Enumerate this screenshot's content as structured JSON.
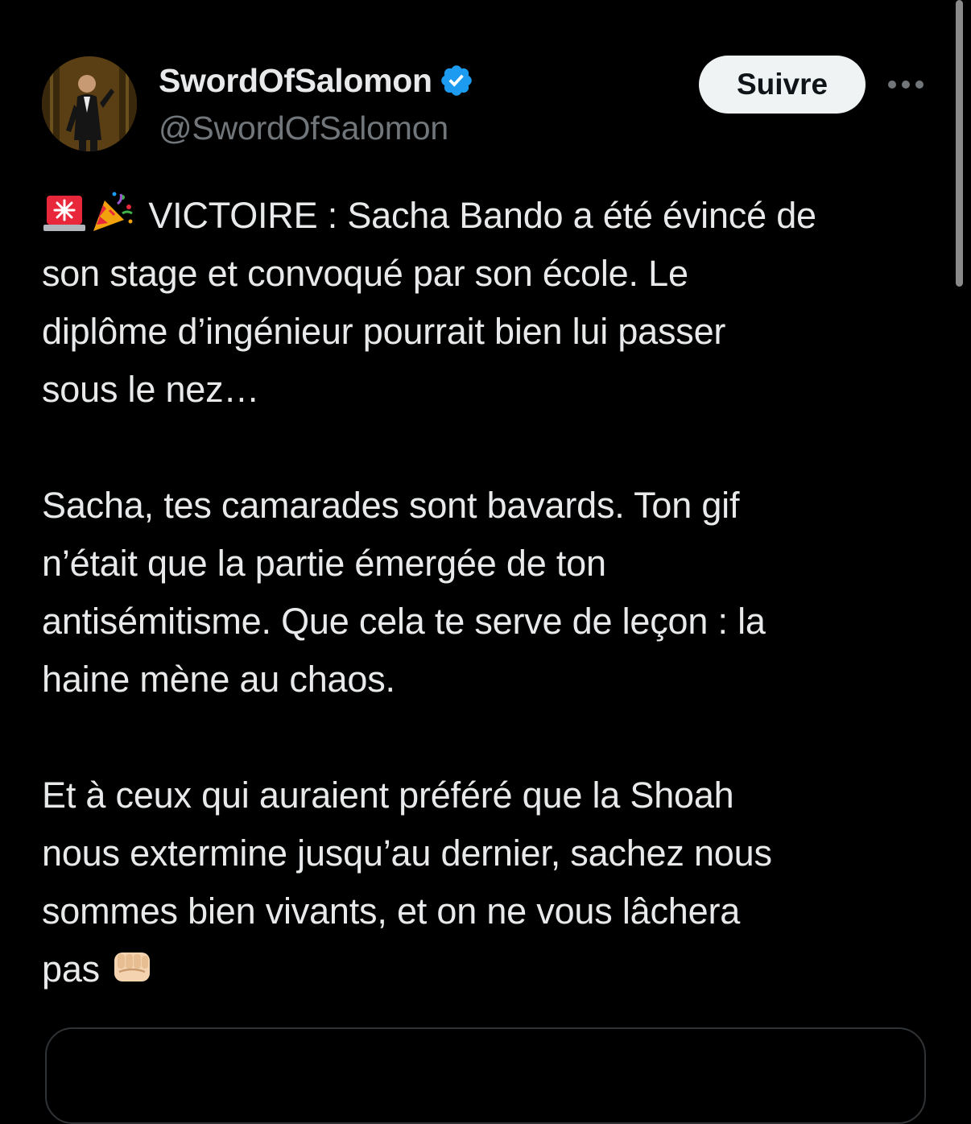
{
  "author": {
    "display_name": "SwordOfSalomon",
    "handle": "@SwordOfSalomon",
    "verified": true
  },
  "actions": {
    "follow_label": "Suivre",
    "more_icon": "more-horizontal-icon"
  },
  "tweet": {
    "emoji_1": "rotating-light-icon",
    "emoji_2": "party-popper-icon",
    "paragraph_1_lines": [
      "VICTOIRE : Sacha Bando a été évincé de",
      "son stage et convoqué par son école. Le",
      "diplôme d’ingénieur pourrait bien lui passer",
      "sous le nez…"
    ],
    "paragraph_2_lines": [
      "Sacha, tes camarades sont bavards. Ton gif",
      "n’était que la partie émergée de ton",
      "antisémitisme. Que cela te serve de leçon : la",
      "haine mène au chaos."
    ],
    "paragraph_3_lines": [
      "Et à ceux qui auraient préféré que la Shoah",
      "nous extermine jusqu’au dernier, sachez nous",
      "sommes bien vivants, et on ne vous lâchera",
      "pas"
    ],
    "emoji_3": "oncoming-fist-icon"
  },
  "colors": {
    "background": "#000000",
    "text": "#e7e9ea",
    "secondary_text": "#71767b",
    "verified_blue": "#1d9bf0",
    "follow_button_bg": "#eff3f4"
  }
}
